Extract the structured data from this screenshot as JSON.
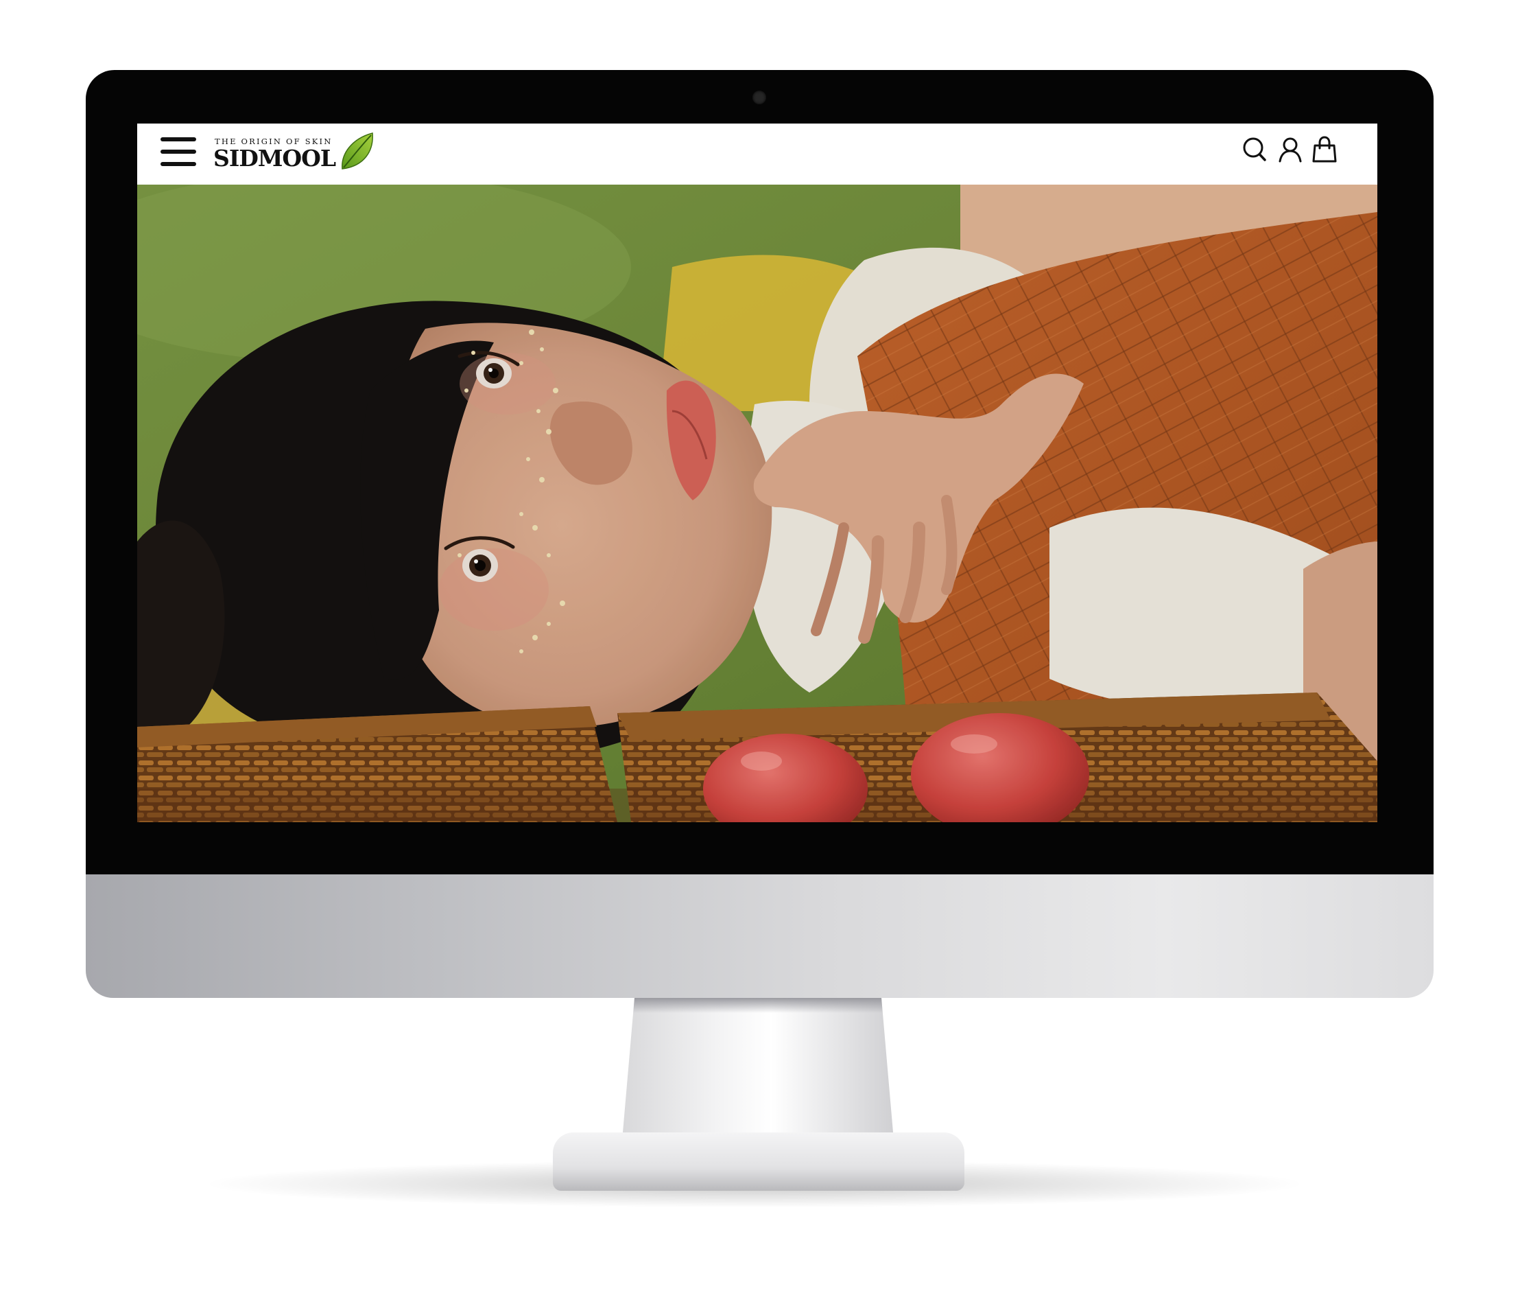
{
  "site": {
    "brand_tagline": "THE ORIGIN OF SKIN",
    "brand_name": "SIDMOOL"
  },
  "header": {
    "menu_icon": "hamburger-menu-icon",
    "icons": [
      "search-icon",
      "user-account-icon",
      "shopping-bag-icon"
    ]
  },
  "hero": {
    "image_subject": "hero-banner-photo"
  },
  "colors": {
    "brand_green": "#7bb02a",
    "header_bg": "#ffffff",
    "bezel": "#050505",
    "icon": "#111111"
  }
}
